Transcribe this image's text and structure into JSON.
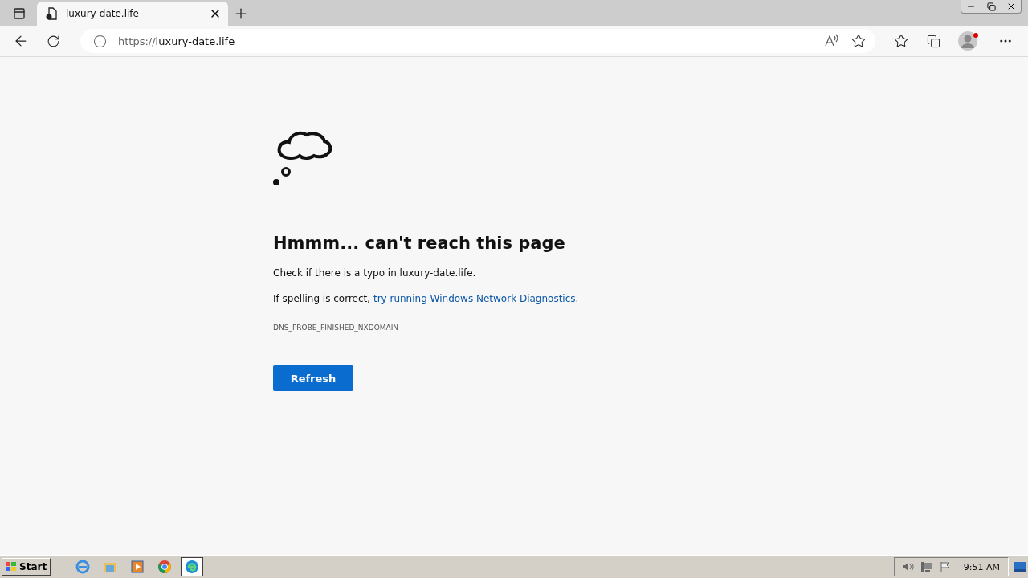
{
  "tab": {
    "title": "luxury-date.life",
    "selected": true
  },
  "address": {
    "scheme": "https://",
    "host": "luxury-date.life"
  },
  "error": {
    "heading": "Hmmm... can't reach this page",
    "hint": "Check if there is a typo in luxury-date.life.",
    "diagnose_prefix": "If spelling is correct, ",
    "diagnose_link": "try running Windows Network Diagnostics",
    "diagnose_suffix": ".",
    "code": "DNS_PROBE_FINISHED_NXDOMAIN",
    "button": "Refresh"
  },
  "taskbar": {
    "start": "Start",
    "apps": [
      {
        "kind": "ie",
        "selected": false
      },
      {
        "kind": "folder",
        "selected": false
      },
      {
        "kind": "media",
        "selected": false
      },
      {
        "kind": "chrome",
        "selected": false
      },
      {
        "kind": "edge",
        "selected": true
      }
    ],
    "clock": "9:51 AM"
  }
}
